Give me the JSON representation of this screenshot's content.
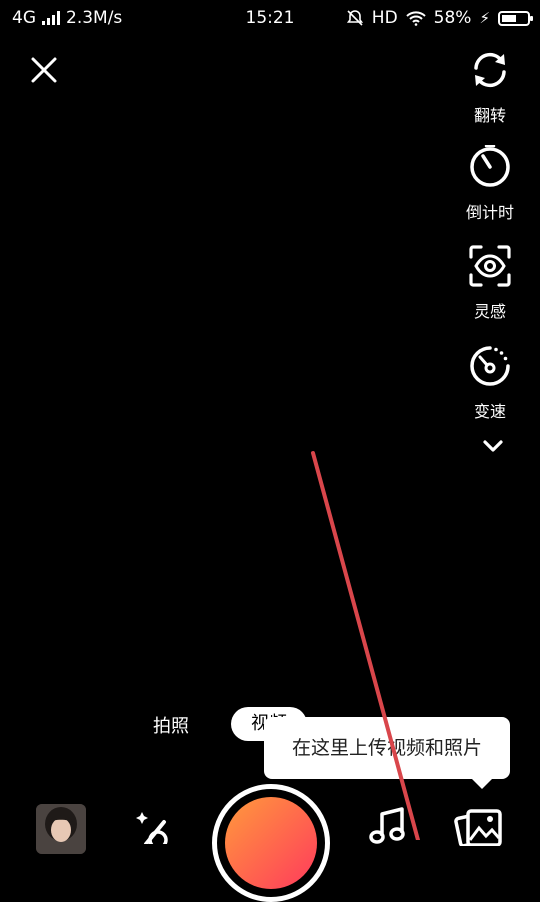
{
  "status_bar": {
    "network": "4G",
    "speed": "2.3M/s",
    "time": "15:21",
    "hd": "HD",
    "battery": "58%",
    "battery_level": 0.58
  },
  "tools": {
    "flip": "翻转",
    "timer": "倒计时",
    "inspiration": "灵感",
    "speed": "变速"
  },
  "modes": {
    "photo": "拍照",
    "video": "视频"
  },
  "tooltip": "在这里上传视频和照片",
  "colors": {
    "record_gradient_start": "#ff9a3c",
    "record_gradient_end": "#ff3a5c",
    "annotation_line": "#d9464b"
  }
}
